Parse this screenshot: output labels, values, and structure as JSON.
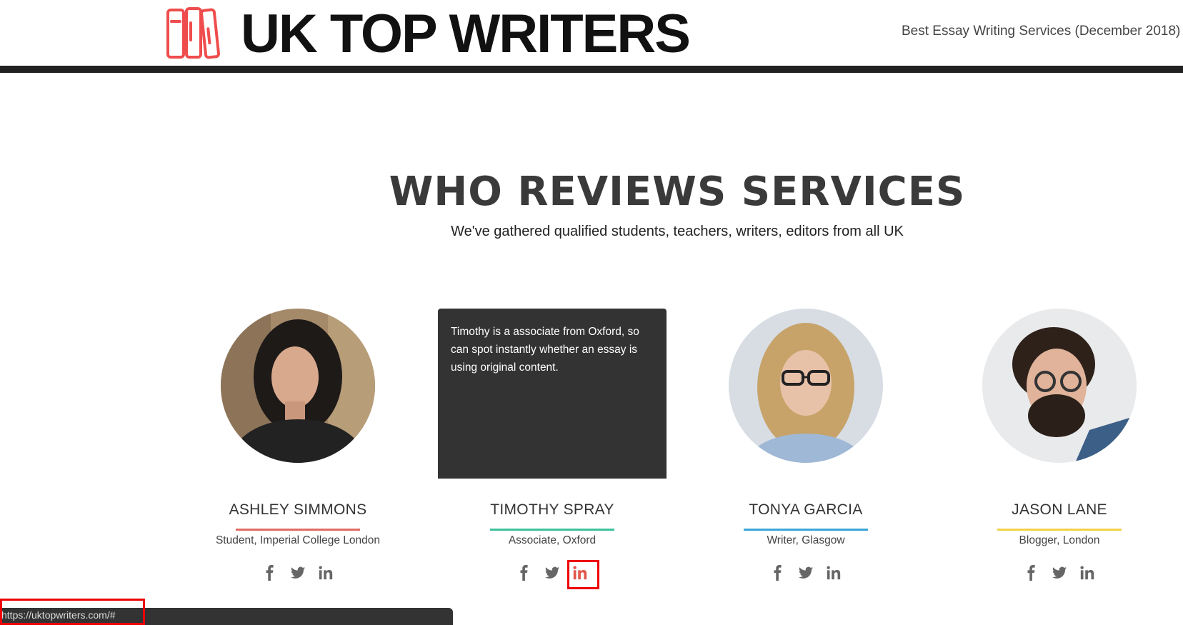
{
  "header": {
    "brand": "UK TOP WRITERS",
    "nav_link": "Best Essay Writing Services (December 2018)",
    "logo_icon": "books-icon",
    "accent": "#ef4d4d"
  },
  "section": {
    "title": "WHO REVIEWS SERVICES",
    "subtitle": "We've gathered qualified students, teachers, writers, editors from all UK"
  },
  "reviewers": [
    {
      "name": "ASHLEY SIMMONS",
      "role": "Student, Imperial College London",
      "underline": "#e06b63",
      "bio": ""
    },
    {
      "name": "TIMOTHY SPRAY",
      "role": "Associate, Oxford",
      "underline": "#3cc39a",
      "bio": "Timothy is a associate from Oxford, so can spot instantly whether an essay is using original content."
    },
    {
      "name": "TONYA GARCIA",
      "role": "Writer, Glasgow",
      "underline": "#3aa7d8",
      "bio": ""
    },
    {
      "name": "JASON LANE",
      "role": "Blogger, London",
      "underline": "#f2d24b",
      "bio": ""
    }
  ],
  "social_icons": [
    "facebook-icon",
    "twitter-icon",
    "linkedin-icon"
  ],
  "status": {
    "url": "https://uktopwriters.com/#"
  }
}
